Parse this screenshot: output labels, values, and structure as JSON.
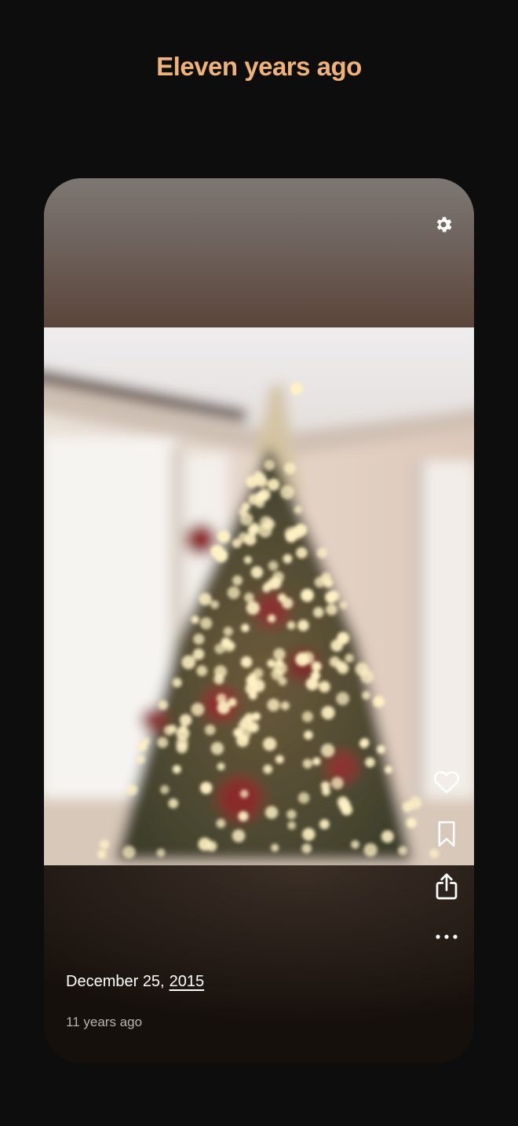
{
  "header": {
    "title": "Eleven years ago",
    "accent_color": "#efb377"
  },
  "card": {
    "settings_icon": "gear-icon",
    "actions": [
      {
        "icon": "heart-icon"
      },
      {
        "icon": "bookmark-icon"
      },
      {
        "icon": "share-icon"
      },
      {
        "icon": "more-horizontal-icon"
      }
    ],
    "date_text": "December 25,",
    "date_year": "2015",
    "relative_text": "11 years ago"
  }
}
